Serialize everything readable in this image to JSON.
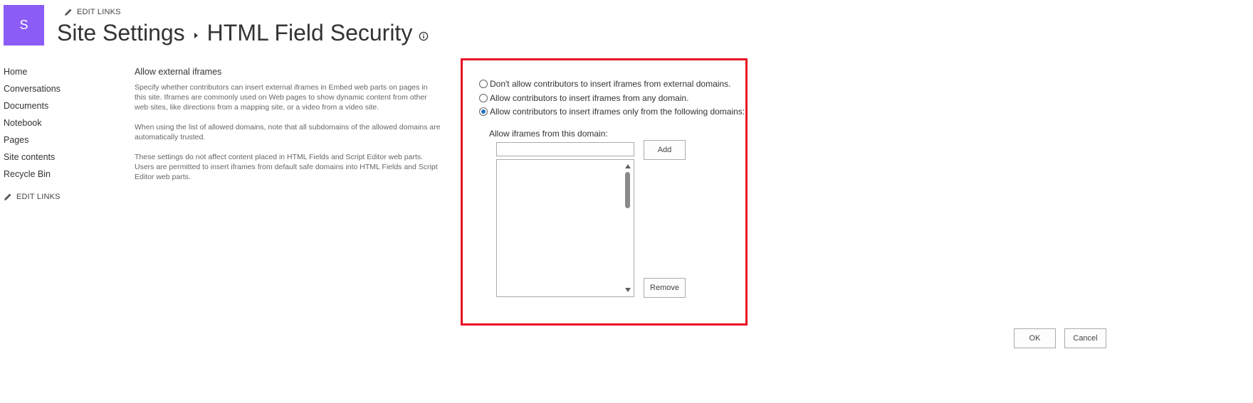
{
  "header": {
    "logo_letter": "S",
    "edit_links": "EDIT LINKS",
    "breadcrumb_parent": "Site Settings",
    "page_title": "HTML Field Security"
  },
  "nav": {
    "items": [
      {
        "label": "Home"
      },
      {
        "label": "Conversations"
      },
      {
        "label": "Documents"
      },
      {
        "label": "Notebook"
      },
      {
        "label": "Pages"
      },
      {
        "label": "Site contents"
      },
      {
        "label": "Recycle Bin"
      }
    ],
    "edit_links": "EDIT LINKS"
  },
  "section": {
    "title": "Allow external iframes",
    "paragraphs": [
      "Specify whether contributors can insert external iframes in Embed web parts on pages in this site. Iframes are commonly used on Web pages to show dynamic content from other web sites, like directions from a mapping site, or a video from a video site.",
      "When using the list of allowed domains, note that all subdomains of the allowed domains are automatically trusted.",
      "These settings do not affect content placed in HTML Fields and Script Editor web parts. Users are permitted to insert iframes from default safe domains into HTML Fields and Script Editor web parts."
    ]
  },
  "options": {
    "radios": [
      {
        "label": "Don't allow contributors to insert iframes from external domains.",
        "checked": false
      },
      {
        "label": "Allow contributors to insert iframes from any domain.",
        "checked": false
      },
      {
        "label": "Allow contributors to insert iframes only from the following domains:",
        "checked": true
      }
    ],
    "domain_label": "Allow iframes from this domain:",
    "domain_input_value": "",
    "domain_list": [],
    "add_label": "Add",
    "remove_label": "Remove"
  },
  "footer": {
    "ok_label": "OK",
    "cancel_label": "Cancel"
  },
  "colors": {
    "logo_bg": "#8b5cf6",
    "highlight_border": "#e81123",
    "radio_selected": "#1f6fbd"
  },
  "icons": {
    "edit": "pencil-icon",
    "info": "info-icon",
    "breadcrumb_separator": "caret-right-icon"
  }
}
